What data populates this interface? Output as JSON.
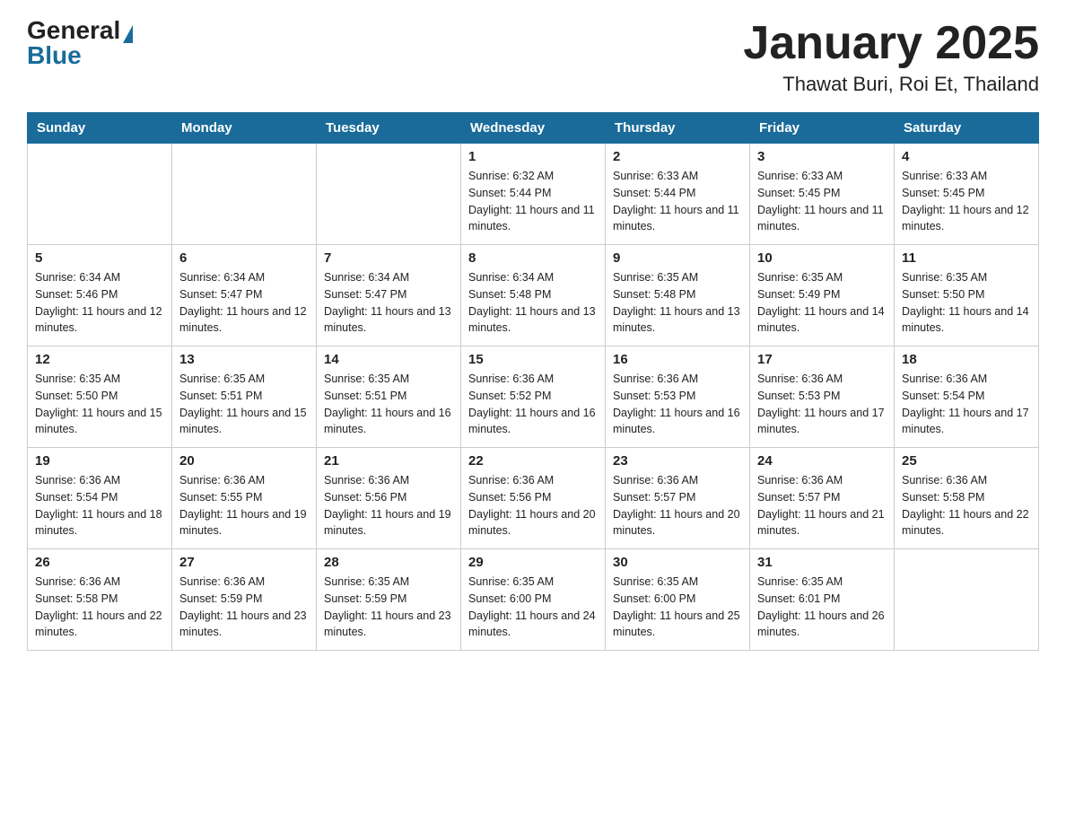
{
  "header": {
    "title": "January 2025",
    "subtitle": "Thawat Buri, Roi Et, Thailand"
  },
  "logo": {
    "general": "General",
    "blue": "Blue"
  },
  "days": [
    "Sunday",
    "Monday",
    "Tuesday",
    "Wednesday",
    "Thursday",
    "Friday",
    "Saturday"
  ],
  "weeks": [
    [
      {
        "date": "",
        "sunrise": "",
        "sunset": "",
        "daylight": ""
      },
      {
        "date": "",
        "sunrise": "",
        "sunset": "",
        "daylight": ""
      },
      {
        "date": "",
        "sunrise": "",
        "sunset": "",
        "daylight": ""
      },
      {
        "date": "1",
        "sunrise": "Sunrise: 6:32 AM",
        "sunset": "Sunset: 5:44 PM",
        "daylight": "Daylight: 11 hours and 11 minutes."
      },
      {
        "date": "2",
        "sunrise": "Sunrise: 6:33 AM",
        "sunset": "Sunset: 5:44 PM",
        "daylight": "Daylight: 11 hours and 11 minutes."
      },
      {
        "date": "3",
        "sunrise": "Sunrise: 6:33 AM",
        "sunset": "Sunset: 5:45 PM",
        "daylight": "Daylight: 11 hours and 11 minutes."
      },
      {
        "date": "4",
        "sunrise": "Sunrise: 6:33 AM",
        "sunset": "Sunset: 5:45 PM",
        "daylight": "Daylight: 11 hours and 12 minutes."
      }
    ],
    [
      {
        "date": "5",
        "sunrise": "Sunrise: 6:34 AM",
        "sunset": "Sunset: 5:46 PM",
        "daylight": "Daylight: 11 hours and 12 minutes."
      },
      {
        "date": "6",
        "sunrise": "Sunrise: 6:34 AM",
        "sunset": "Sunset: 5:47 PM",
        "daylight": "Daylight: 11 hours and 12 minutes."
      },
      {
        "date": "7",
        "sunrise": "Sunrise: 6:34 AM",
        "sunset": "Sunset: 5:47 PM",
        "daylight": "Daylight: 11 hours and 13 minutes."
      },
      {
        "date": "8",
        "sunrise": "Sunrise: 6:34 AM",
        "sunset": "Sunset: 5:48 PM",
        "daylight": "Daylight: 11 hours and 13 minutes."
      },
      {
        "date": "9",
        "sunrise": "Sunrise: 6:35 AM",
        "sunset": "Sunset: 5:48 PM",
        "daylight": "Daylight: 11 hours and 13 minutes."
      },
      {
        "date": "10",
        "sunrise": "Sunrise: 6:35 AM",
        "sunset": "Sunset: 5:49 PM",
        "daylight": "Daylight: 11 hours and 14 minutes."
      },
      {
        "date": "11",
        "sunrise": "Sunrise: 6:35 AM",
        "sunset": "Sunset: 5:50 PM",
        "daylight": "Daylight: 11 hours and 14 minutes."
      }
    ],
    [
      {
        "date": "12",
        "sunrise": "Sunrise: 6:35 AM",
        "sunset": "Sunset: 5:50 PM",
        "daylight": "Daylight: 11 hours and 15 minutes."
      },
      {
        "date": "13",
        "sunrise": "Sunrise: 6:35 AM",
        "sunset": "Sunset: 5:51 PM",
        "daylight": "Daylight: 11 hours and 15 minutes."
      },
      {
        "date": "14",
        "sunrise": "Sunrise: 6:35 AM",
        "sunset": "Sunset: 5:51 PM",
        "daylight": "Daylight: 11 hours and 16 minutes."
      },
      {
        "date": "15",
        "sunrise": "Sunrise: 6:36 AM",
        "sunset": "Sunset: 5:52 PM",
        "daylight": "Daylight: 11 hours and 16 minutes."
      },
      {
        "date": "16",
        "sunrise": "Sunrise: 6:36 AM",
        "sunset": "Sunset: 5:53 PM",
        "daylight": "Daylight: 11 hours and 16 minutes."
      },
      {
        "date": "17",
        "sunrise": "Sunrise: 6:36 AM",
        "sunset": "Sunset: 5:53 PM",
        "daylight": "Daylight: 11 hours and 17 minutes."
      },
      {
        "date": "18",
        "sunrise": "Sunrise: 6:36 AM",
        "sunset": "Sunset: 5:54 PM",
        "daylight": "Daylight: 11 hours and 17 minutes."
      }
    ],
    [
      {
        "date": "19",
        "sunrise": "Sunrise: 6:36 AM",
        "sunset": "Sunset: 5:54 PM",
        "daylight": "Daylight: 11 hours and 18 minutes."
      },
      {
        "date": "20",
        "sunrise": "Sunrise: 6:36 AM",
        "sunset": "Sunset: 5:55 PM",
        "daylight": "Daylight: 11 hours and 19 minutes."
      },
      {
        "date": "21",
        "sunrise": "Sunrise: 6:36 AM",
        "sunset": "Sunset: 5:56 PM",
        "daylight": "Daylight: 11 hours and 19 minutes."
      },
      {
        "date": "22",
        "sunrise": "Sunrise: 6:36 AM",
        "sunset": "Sunset: 5:56 PM",
        "daylight": "Daylight: 11 hours and 20 minutes."
      },
      {
        "date": "23",
        "sunrise": "Sunrise: 6:36 AM",
        "sunset": "Sunset: 5:57 PM",
        "daylight": "Daylight: 11 hours and 20 minutes."
      },
      {
        "date": "24",
        "sunrise": "Sunrise: 6:36 AM",
        "sunset": "Sunset: 5:57 PM",
        "daylight": "Daylight: 11 hours and 21 minutes."
      },
      {
        "date": "25",
        "sunrise": "Sunrise: 6:36 AM",
        "sunset": "Sunset: 5:58 PM",
        "daylight": "Daylight: 11 hours and 22 minutes."
      }
    ],
    [
      {
        "date": "26",
        "sunrise": "Sunrise: 6:36 AM",
        "sunset": "Sunset: 5:58 PM",
        "daylight": "Daylight: 11 hours and 22 minutes."
      },
      {
        "date": "27",
        "sunrise": "Sunrise: 6:36 AM",
        "sunset": "Sunset: 5:59 PM",
        "daylight": "Daylight: 11 hours and 23 minutes."
      },
      {
        "date": "28",
        "sunrise": "Sunrise: 6:35 AM",
        "sunset": "Sunset: 5:59 PM",
        "daylight": "Daylight: 11 hours and 23 minutes."
      },
      {
        "date": "29",
        "sunrise": "Sunrise: 6:35 AM",
        "sunset": "Sunset: 6:00 PM",
        "daylight": "Daylight: 11 hours and 24 minutes."
      },
      {
        "date": "30",
        "sunrise": "Sunrise: 6:35 AM",
        "sunset": "Sunset: 6:00 PM",
        "daylight": "Daylight: 11 hours and 25 minutes."
      },
      {
        "date": "31",
        "sunrise": "Sunrise: 6:35 AM",
        "sunset": "Sunset: 6:01 PM",
        "daylight": "Daylight: 11 hours and 26 minutes."
      },
      {
        "date": "",
        "sunrise": "",
        "sunset": "",
        "daylight": ""
      }
    ]
  ]
}
